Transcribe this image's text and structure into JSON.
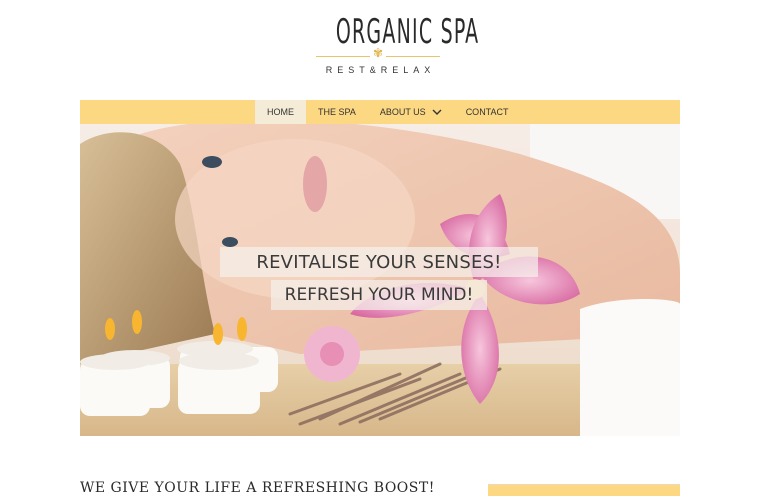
{
  "logo": {
    "title": "ORGANIC SPA",
    "tagline": "REST&RELAX",
    "flower_glyph": "✾",
    "accent_color": "#e0b54d"
  },
  "nav": {
    "background_color": "#fdd882",
    "items": [
      {
        "label": "HOME",
        "active": true
      },
      {
        "label": "THE SPA",
        "active": false
      },
      {
        "label": "ABOUT US",
        "active": false,
        "dropdown": true
      },
      {
        "label": "CONTACT",
        "active": false
      }
    ]
  },
  "hero": {
    "headline": "REVITALISE YOUR SENSES!",
    "subheadline": "REFRESH YOUR MIND!"
  },
  "content": {
    "heading": "WE GIVE YOUR LIFE A REFRESHING BOOST!"
  }
}
